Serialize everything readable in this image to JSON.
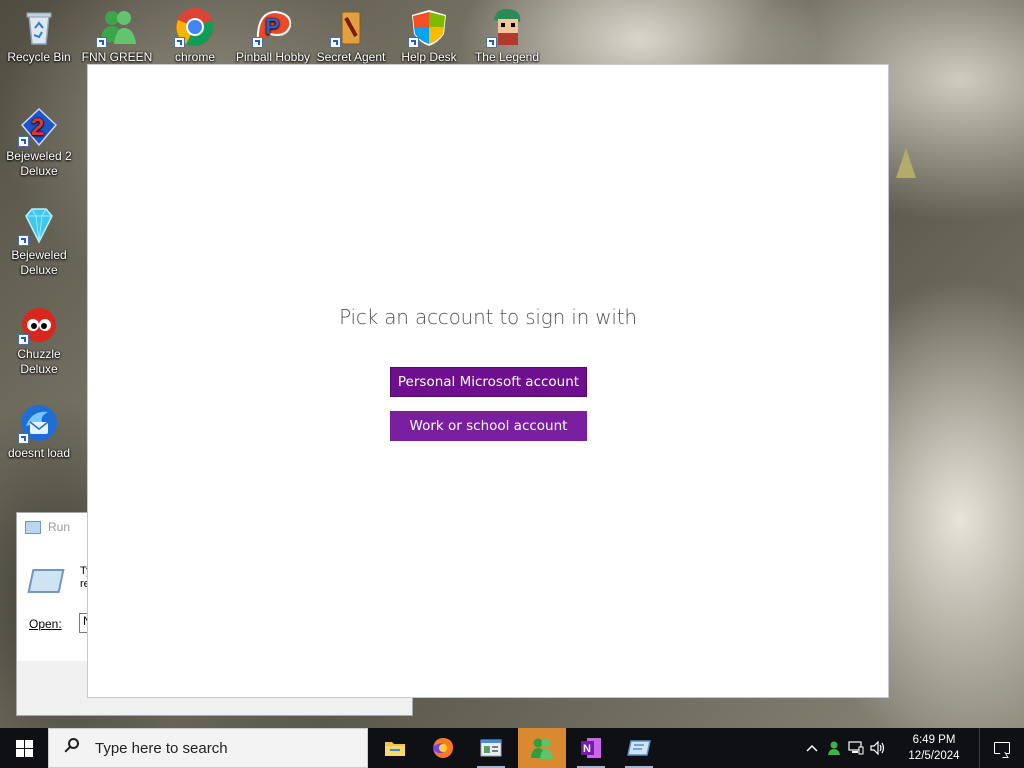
{
  "desktop": {
    "icons": [
      {
        "label": "Recycle Bin",
        "icon": "recycle-bin-icon"
      },
      {
        "label": "FNN GREEN",
        "icon": "messenger-icon"
      },
      {
        "label": "chrome",
        "icon": "chrome-icon"
      },
      {
        "label": "Pinball Hobby",
        "icon": "pinball-icon"
      },
      {
        "label": "Secret Agent",
        "icon": "game-icon"
      },
      {
        "label": "Help Desk",
        "icon": "windows-shield-icon"
      },
      {
        "label": "The Legend",
        "icon": "character-icon"
      },
      {
        "label": "Bejeweled 2 Deluxe",
        "icon": "bejeweled-2-icon"
      },
      {
        "label": "Bejeweled Deluxe",
        "icon": "diamond-icon"
      },
      {
        "label": "Chuzzle Deluxe",
        "icon": "chuzzle-icon"
      },
      {
        "label": "doesnt load",
        "icon": "thunderbird-icon"
      }
    ]
  },
  "run_dialog": {
    "title": "Run",
    "description": "Ty\nre",
    "open_label": "Open:",
    "open_value": "N"
  },
  "signin": {
    "prompt": "Pick an account to sign in with",
    "personal_button": "Personal Microsoft account",
    "work_button": "Work or school account",
    "accent_color": "#7a1fa0"
  },
  "taskbar": {
    "search_placeholder": "Type here to search",
    "apps": [
      {
        "name": "file-explorer",
        "icon": "folder-icon"
      },
      {
        "name": "firefox",
        "icon": "firefox-icon"
      },
      {
        "name": "control-panel",
        "icon": "window-icon"
      },
      {
        "name": "messenger",
        "icon": "messenger-icon",
        "active": true
      },
      {
        "name": "onenote",
        "icon": "onenote-icon"
      },
      {
        "name": "run",
        "icon": "run-icon"
      }
    ],
    "clock_time": "6:49 PM",
    "clock_date": "12/5/2024"
  }
}
